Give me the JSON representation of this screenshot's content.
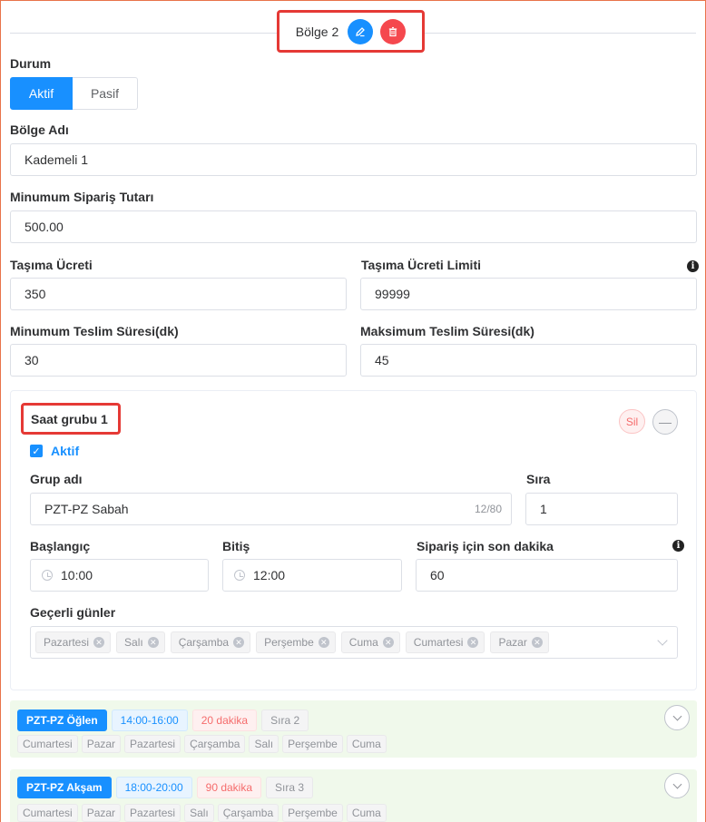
{
  "zone": {
    "title": "Bölge 2",
    "edit_icon": "edit-icon",
    "delete_icon": "delete-icon"
  },
  "status": {
    "label": "Durum",
    "active": "Aktif",
    "passive": "Pasif",
    "selected": "Aktif"
  },
  "zone_name": {
    "label": "Bölge Adı",
    "value": "Kademeli 1"
  },
  "min_order": {
    "label": "Minumum Sipariş Tutarı",
    "value": "500.00"
  },
  "shipping_fee": {
    "label": "Taşıma Ücreti",
    "value": "350"
  },
  "shipping_limit": {
    "label": "Taşıma Ücreti Limiti",
    "value": "99999"
  },
  "min_delivery": {
    "label": "Minumum Teslim Süresi(dk)",
    "value": "30"
  },
  "max_delivery": {
    "label": "Maksimum Teslim Süresi(dk)",
    "value": "45"
  },
  "time_group": {
    "title": "Saat grubu 1",
    "delete_label": "Sil",
    "active_label": "Aktif",
    "active_checked": true,
    "group_name": {
      "label": "Grup adı",
      "value": "PZT-PZ Sabah",
      "counter": "12/80"
    },
    "order": {
      "label": "Sıra",
      "value": "1"
    },
    "start": {
      "label": "Başlangıç",
      "value": "10:00"
    },
    "end": {
      "label": "Bitiş",
      "value": "12:00"
    },
    "last_minute": {
      "label": "Sipariş için son dakika",
      "value": "60"
    },
    "valid_days": {
      "label": "Geçerli günler",
      "tags": [
        "Pazartesi",
        "Salı",
        "Çarşamba",
        "Perşembe",
        "Cuma",
        "Cumartesi",
        "Pazar"
      ]
    }
  },
  "groups": [
    {
      "name": "PZT-PZ Öğlen",
      "time": "14:00-16:00",
      "duration": "20 dakika",
      "order": "Sıra 2",
      "days": [
        "Cumartesi",
        "Pazar",
        "Pazartesi",
        "Çarşamba",
        "Salı",
        "Perşembe",
        "Cuma"
      ]
    },
    {
      "name": "PZT-PZ Akşam",
      "time": "18:00-20:00",
      "duration": "90 dakika",
      "order": "Sıra 3",
      "days": [
        "Cumartesi",
        "Pazar",
        "Pazartesi",
        "Salı",
        "Çarşamba",
        "Perşembe",
        "Cuma"
      ]
    }
  ],
  "colors": {
    "primary": "#1890ff",
    "danger": "#f5484e",
    "highlight_border": "#e53935",
    "panel_green": "#f0f9eb"
  }
}
